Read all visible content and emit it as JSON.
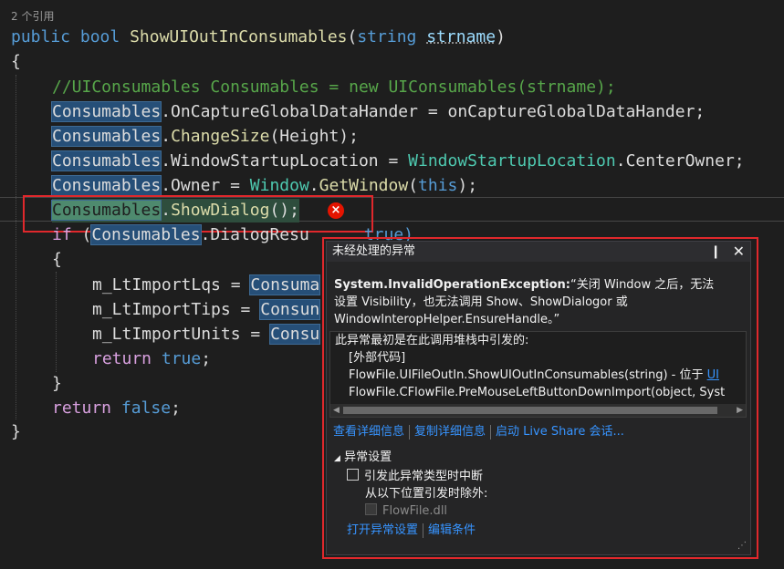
{
  "code": {
    "refs": "2 个引用",
    "l1": {
      "kw1": "public",
      "kw2": "bool",
      "fn": "ShowUIOutInConsumables",
      "p1": "(",
      "ptype": "string",
      "pname": "strname",
      "p2": ")"
    },
    "l2": "{",
    "l3": "//UIConsumables Consumables = new UIConsumables(strname);",
    "l4": {
      "obj": "Consumables",
      "rest": ".OnCaptureGlobalDataHander = onCaptureGlobalDataHander;"
    },
    "l5": {
      "obj": "Consumables",
      "dot": ".",
      "fn": "ChangeSize",
      "rest": "(Height);"
    },
    "l6": {
      "obj": "Consumables",
      "prop": ".WindowStartupLocation = ",
      "ty": "WindowStartupLocation",
      "rest": ".CenterOwner;"
    },
    "l7": {
      "obj": "Consumables",
      "prop": ".Owner = ",
      "ty": "Window",
      "dot": ".",
      "fn": "GetWindow",
      "p1": "(",
      "kw": "this",
      "p2": ");"
    },
    "l8": {
      "obj": "Consumables",
      "dot": ".",
      "fn": "ShowDialog",
      "rest": "();"
    },
    "l9": {
      "kw": "if",
      "p1": " (",
      "obj": "Consumables",
      "rest": ".DialogResu",
      "tail": "true)"
    },
    "l10": "{",
    "l11": {
      "var": "m_LtImportLqs = ",
      "obj": "Consuma"
    },
    "l12": {
      "var": "m_LtImportTips = ",
      "obj": "Consun"
    },
    "l13": {
      "var": "m_LtImportUnits = ",
      "obj": "Consu"
    },
    "l14": {
      "kw": "return",
      "val": " true",
      "end": ";"
    },
    "l15": "}",
    "l16": {
      "kw": "return",
      "val": " false",
      "end": ";"
    },
    "l17": "}"
  },
  "error_icon": "×",
  "popup": {
    "title": "未经处理的异常",
    "pin": "❙",
    "close": "✕",
    "exception_type": "System.InvalidOperationException:",
    "exception_msg_1": "“关闭 Window 之后，无法",
    "exception_msg_2": "设置 Visibility，也无法调用 Show、ShowDialogor 或",
    "exception_msg_3": "WindowInteropHelper.EnsureHandle。”",
    "stack_header": "此异常最初是在此调用堆栈中引发的:",
    "stack_1": "[外部代码]",
    "stack_2_text": "FlowFile.UIFileOutIn.ShowUIOutInConsumables(string) - 位于 ",
    "stack_2_link": "UI",
    "stack_3": "FlowFile.CFlowFile.PreMouseLeftButtonDownImport(object, Syst",
    "view_details": "查看详细信息",
    "copy_details": "复制详细信息",
    "live_share": "启动 Live Share 会话...",
    "section_title": "异常设置",
    "break_label": "引发此异常类型时中断",
    "except_label": "从以下位置引发时除外:",
    "module": "FlowFile.dll",
    "open_settings": "打开异常设置",
    "edit_conditions": "编辑条件"
  }
}
